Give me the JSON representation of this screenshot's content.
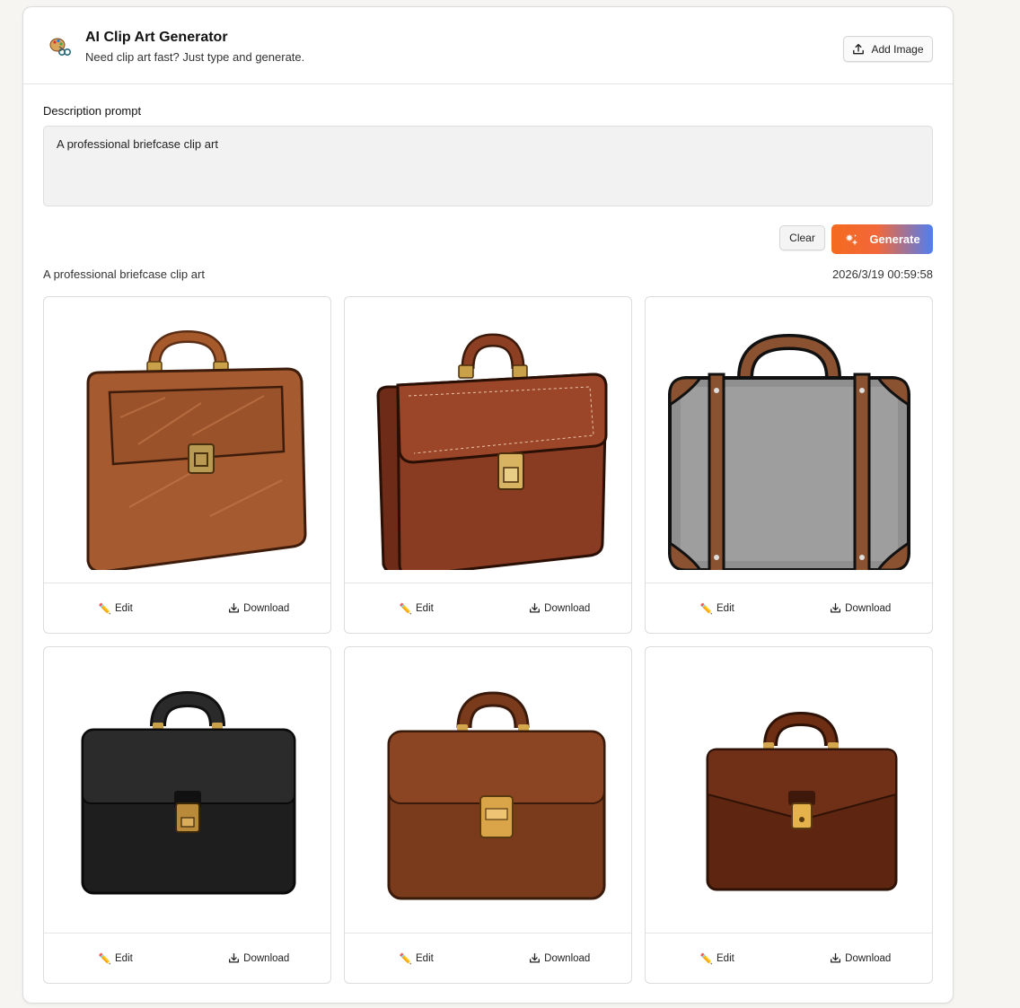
{
  "header": {
    "title": "AI Clip Art Generator",
    "subtitle": "Need clip art fast? Just type and generate.",
    "add_image_label": "Add Image"
  },
  "prompt": {
    "label": "Description prompt",
    "value": "A professional briefcase clip art"
  },
  "actions": {
    "clear_label": "Clear",
    "generate_label": "Generate"
  },
  "result": {
    "caption": "A professional briefcase clip art",
    "timestamp": "2026/3/19 00:59:58"
  },
  "cards": [
    {
      "image": "brown-leather-briefcase-sketch",
      "edit_label": "Edit",
      "download_label": "Download"
    },
    {
      "image": "brown-flap-briefcase",
      "edit_label": "Edit",
      "download_label": "Download"
    },
    {
      "image": "gray-suitcase",
      "edit_label": "Edit",
      "download_label": "Download"
    },
    {
      "image": "black-briefcase",
      "edit_label": "Edit",
      "download_label": "Download"
    },
    {
      "image": "brown-briefcase",
      "edit_label": "Edit",
      "download_label": "Download"
    },
    {
      "image": "dark-brown-briefcase",
      "edit_label": "Edit",
      "download_label": "Download"
    }
  ],
  "colors": {
    "generate_gradient_start": "#f46a1f",
    "generate_gradient_end": "#4f7ef2"
  }
}
